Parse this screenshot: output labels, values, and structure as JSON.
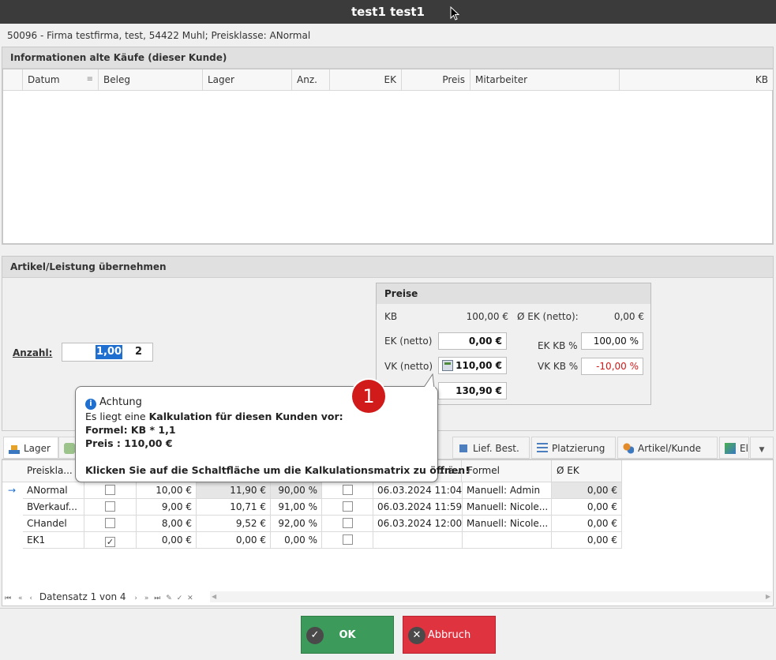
{
  "window": {
    "title": "test1 test1"
  },
  "customer_line": "50096 - Firma testfirma, test, 54422 Muhl; Preisklasse: ANormal",
  "old_purchases": {
    "title": "Informationen alte Käufe (dieser Kunde)",
    "columns": [
      "Datum",
      "Beleg",
      "Lager",
      "Anz.",
      "EK",
      "Preis",
      "Mitarbeiter",
      "KB"
    ]
  },
  "article": {
    "title": "Artikel/Leistung übernehmen",
    "quantity_label": "Anzahl:",
    "quantity_value": "1,00",
    "quantity_unit": "2",
    "prices": {
      "title": "Preise",
      "kb_label": "KB",
      "kb_value": "100,00 €",
      "avg_ek_label": "Ø EK (netto):",
      "avg_ek_value": "0,00 €",
      "ek_label": "EK (netto)",
      "ek_value": "0,00 €",
      "vk_label": "VK (netto)",
      "vk_value": "110,00 €",
      "brutto_value": "130,90 €",
      "ek_kb_label": "EK KB %",
      "ek_kb_value": "100,00 %",
      "vk_kb_label": "VK KB %",
      "vk_kb_value": "-10,00 %"
    }
  },
  "tabs": [
    "Lager",
    "Lief. Best.",
    "Platzierung",
    "Artikel/Kunde",
    "El"
  ],
  "price_grid": {
    "headers": {
      "preisklasse": "Preiskla...",
      "date": "...ä...",
      "formel": "Formel",
      "avg_ek": "Ø EK"
    },
    "rows": [
      {
        "name": "ANormal",
        "checked": false,
        "netto": "10,00 €",
        "brutto": "11,90 €",
        "pct": "90,00 %",
        "checked2": false,
        "date": "06.03.2024 11:04",
        "formel": "Manuell: Admin",
        "avg_ek": "0,00 €"
      },
      {
        "name": "BVerkauf...",
        "checked": false,
        "netto": "9,00 €",
        "brutto": "10,71 €",
        "pct": "91,00 %",
        "checked2": false,
        "date": "06.03.2024 11:59",
        "formel": "Manuell: Nicole...",
        "avg_ek": "0,00 €"
      },
      {
        "name": "CHandel",
        "checked": false,
        "netto": "8,00 €",
        "brutto": "9,52 €",
        "pct": "92,00 %",
        "checked2": false,
        "date": "06.03.2024 12:00",
        "formel": "Manuell: Nicole...",
        "avg_ek": "0,00 €"
      },
      {
        "name": "EK1",
        "checked": true,
        "netto": "0,00 €",
        "brutto": "0,00 €",
        "pct": "0,00 %",
        "checked2": false,
        "date": "",
        "formel": "",
        "avg_ek": "0,00 €"
      }
    ],
    "record_text": "Datensatz 1 von 4"
  },
  "tooltip": {
    "title": "Achtung",
    "line1_prefix": "Es liegt eine ",
    "line1_bold": "Kalkulation für diesen Kunden vor:",
    "formula": "Formel: KB * 1,1",
    "price": "Preis : 110,00 €",
    "hint": "Klicken Sie auf die Schaltfläche um die Kalkulationsmatrix zu öffnen!",
    "badge": "1"
  },
  "buttons": {
    "ok": "OK",
    "cancel": "Abbruch"
  },
  "colors": {
    "ok": "#3c9b5a",
    "cancel": "#e03340",
    "badge": "#d11a1a",
    "negative": "#d11a1a"
  }
}
